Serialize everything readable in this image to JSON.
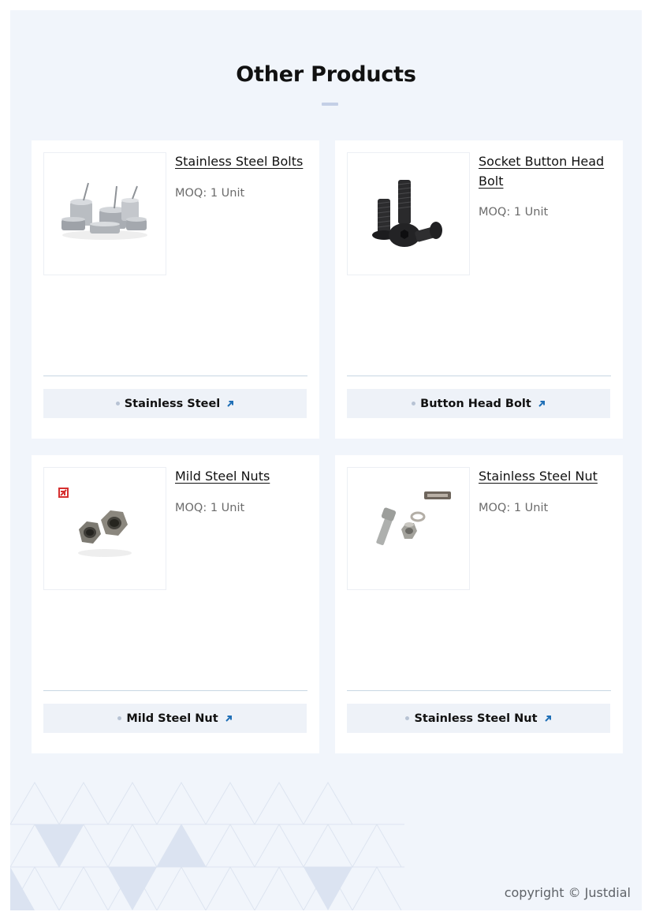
{
  "section": {
    "title": "Other Products"
  },
  "products": [
    {
      "name": "Stainless Steel Bolts",
      "moq": "MOQ: 1 Unit",
      "tag": "Stainless Steel",
      "image_icon": "cookware-set-icon"
    },
    {
      "name": "Socket Button Head Bolt",
      "moq": "MOQ: 1 Unit",
      "tag": "Button Head Bolt",
      "image_icon": "button-head-bolt-icon"
    },
    {
      "name": "Mild Steel Nuts",
      "moq": "MOQ: 1 Unit",
      "tag": "Mild Steel Nut",
      "image_icon": "hex-nut-icon"
    },
    {
      "name": "Stainless Steel Nut",
      "moq": "MOQ: 1 Unit",
      "tag": "Stainless Steel Nut",
      "image_icon": "bolt-nut-washer-icon"
    }
  ],
  "footer": {
    "copyright": "copyright © Justdial"
  },
  "colors": {
    "page_bg": "#f1f5fb",
    "card_bg": "#ffffff",
    "tag_bg": "#eef2f8",
    "arrow": "#1f6fb6",
    "divider": "#c8d6e3"
  }
}
